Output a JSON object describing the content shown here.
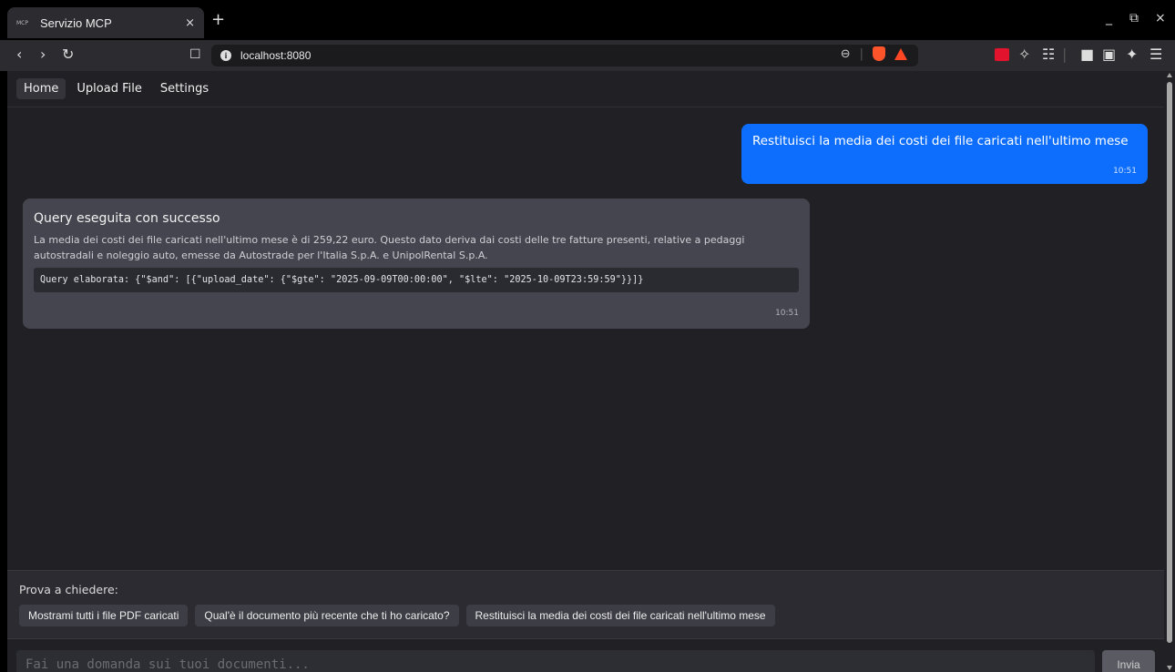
{
  "browser": {
    "tab_title": "Servizio MCP",
    "tab_favicon_text": "MCP",
    "tab_close": "×",
    "new_tab": "+",
    "url": "localhost:8080",
    "window_controls": {
      "minimize": "_",
      "restore": "⧉",
      "close": "×"
    }
  },
  "nav": {
    "items": [
      {
        "label": "Home",
        "active": true
      },
      {
        "label": "Upload File",
        "active": false
      },
      {
        "label": "Settings",
        "active": false
      }
    ]
  },
  "chat": {
    "user_message": {
      "text": "Restituisci la media dei costi dei file caricati nell'ultimo mese",
      "time": "10:51"
    },
    "bot_message": {
      "title": "Query eseguita con successo",
      "body": "La media dei costi dei file caricati nell'ultimo mese è di 259,22 euro. Questo dato deriva dai costi delle tre fatture presenti, relative a pedaggi autostradali e noleggio auto, emesse da Autostrade per l'Italia S.p.A. e UnipolRental S.p.A.",
      "code": "Query elaborata: {\"$and\": [{\"upload_date\": {\"$gte\": \"2025-09-09T00:00:00\", \"$lte\": \"2025-10-09T23:59:59\"}}]}",
      "time": "10:51"
    }
  },
  "suggestions": {
    "label": "Prova a chiedere:",
    "items": [
      "Mostrami tutti i file PDF caricati",
      "Qual'è il documento più recente che ti ho caricato?",
      "Restituisci la media dei costi dei file caricati nell'ultimo mese"
    ]
  },
  "input": {
    "placeholder": "Fai una domanda sui tuoi documenti...",
    "value": "",
    "send_label": "Invia"
  },
  "colors": {
    "user_bubble": "#0d6efd",
    "bot_bubble": "#45454f",
    "page_bg": "#212125"
  }
}
